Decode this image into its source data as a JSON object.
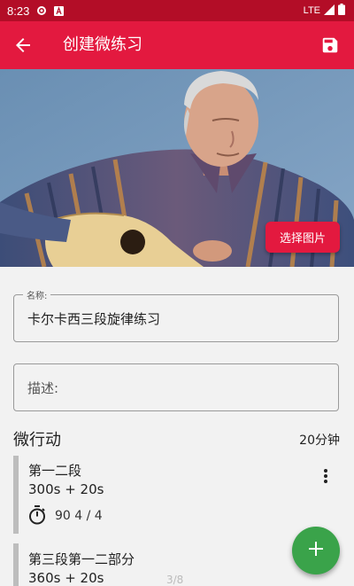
{
  "status_bar": {
    "time": "8:23",
    "network": "LTE",
    "icons": [
      "gear-icon",
      "text-a-icon",
      "signal-icon",
      "battery-icon"
    ]
  },
  "toolbar": {
    "title": "创建微练习",
    "back_icon": "arrow-left-icon",
    "save_icon": "floppy-disk-icon"
  },
  "photo": {
    "choose_label": "选择图片"
  },
  "form": {
    "name_label": "名称:",
    "name_value": "卡尔卡西三段旋律练习",
    "description_placeholder": "描述:"
  },
  "section": {
    "title": "微行动",
    "total": "20分钟"
  },
  "items": [
    {
      "name": "第一二段",
      "time": "300s + 20s",
      "stats": "90 4 / 4"
    },
    {
      "name": "第三段第一二部分",
      "time": "360s + 20s"
    }
  ],
  "page_indicator": "3/8",
  "colors": {
    "status_bar": "#b30d27",
    "toolbar": "#e3193f",
    "accent": "#e3193f",
    "fab": "#3aa34a",
    "background": "#f2f2f2"
  }
}
